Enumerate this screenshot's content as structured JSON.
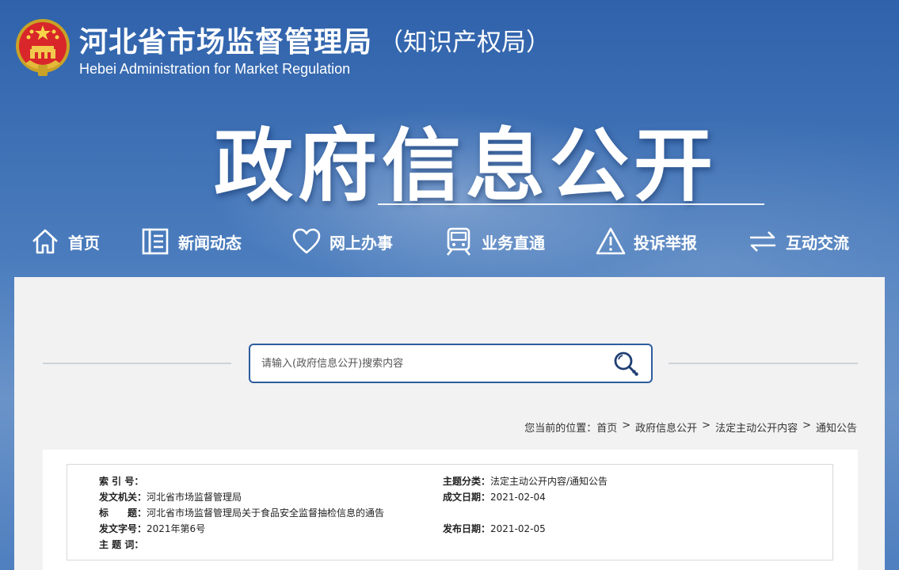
{
  "header": {
    "title": "河北省市场监督管理局",
    "subtitle": "（知识产权局）",
    "title_en": "Hebei Administration for Market Regulation",
    "big_title": "政府信息公开"
  },
  "nav": [
    {
      "label": "首页",
      "icon": "home-icon"
    },
    {
      "label": "新闻动态",
      "icon": "news-icon"
    },
    {
      "label": "网上办事",
      "icon": "heart-icon"
    },
    {
      "label": "业务直通",
      "icon": "train-icon"
    },
    {
      "label": "投诉举报",
      "icon": "warning-icon"
    },
    {
      "label": "互动交流",
      "icon": "exchange-icon"
    }
  ],
  "search": {
    "placeholder": "请输入(政府信息公开)搜索内容"
  },
  "breadcrumb": {
    "prefix": "您当前的位置：",
    "items": [
      "首页",
      "政府信息公开",
      "法定主动公开内容",
      "通知公告"
    ],
    "separator": ">"
  },
  "meta": {
    "index_key": "索 引 号：",
    "index_val": "",
    "issuer_key": "发文机关：",
    "issuer_val": "河北省市场监督管理局",
    "title_key": "标　　题：",
    "title_val": "河北省市场监督管理局关于食品安全监督抽检信息的通告",
    "docno_key": "发文字号：",
    "docno_val": "2021年第6号",
    "subject_key": "主 题 词：",
    "subject_val": "",
    "category_key": "主题分类：",
    "category_val": "法定主动公开内容/通知公告",
    "created_key": "成文日期：",
    "created_val": "2021-02-04",
    "published_key": "发布日期：",
    "published_val": "2021-02-05"
  },
  "colors": {
    "banner_blue": "#3f6fb0",
    "search_border": "#2d5d9e",
    "panel_bg": "#f2f2f2"
  }
}
